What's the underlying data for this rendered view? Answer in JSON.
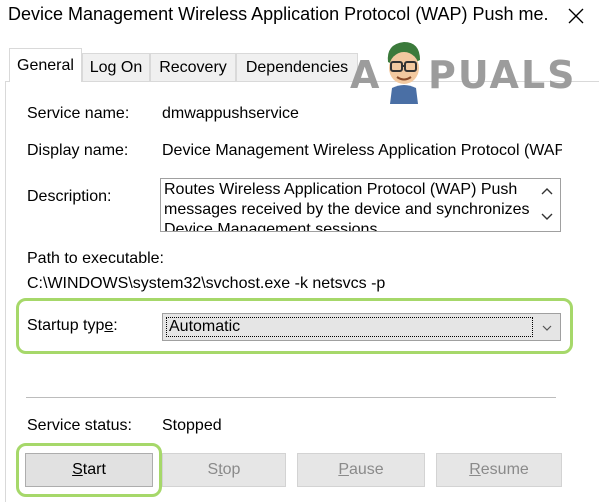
{
  "window": {
    "title": "Device Management Wireless Application Protocol (WAP) Push me..."
  },
  "tabs": [
    {
      "label": "General",
      "active": true
    },
    {
      "label": "Log On",
      "active": false
    },
    {
      "label": "Recovery",
      "active": false
    },
    {
      "label": "Dependencies",
      "active": false
    }
  ],
  "general": {
    "service_name_label": "Service name:",
    "service_name_value": "dmwappushservice",
    "display_name_label": "Display name:",
    "display_name_value": "Device Management Wireless Application Protocol (WAP)",
    "description_label": "Description:",
    "description_lines": [
      "Routes Wireless Application Protocol (WAP) Push",
      "messages received by the device and synchronizes",
      "Device Management sessions"
    ],
    "path_label": "Path to executable:",
    "path_value": "C:\\WINDOWS\\system32\\svchost.exe -k netsvcs -p",
    "startup_type_label": "Startup type:",
    "startup_type_value": "Automatic",
    "service_status_label": "Service status:",
    "service_status_value": "Stopped"
  },
  "buttons": {
    "start": "Start",
    "stop": "Stop",
    "pause": "Pause",
    "resume": "Resume"
  },
  "watermark": {
    "text_left": "A",
    "text_right": "PUALS"
  },
  "colors": {
    "highlight": "#a6d86a",
    "disabled_text": "#8a8a8a"
  }
}
